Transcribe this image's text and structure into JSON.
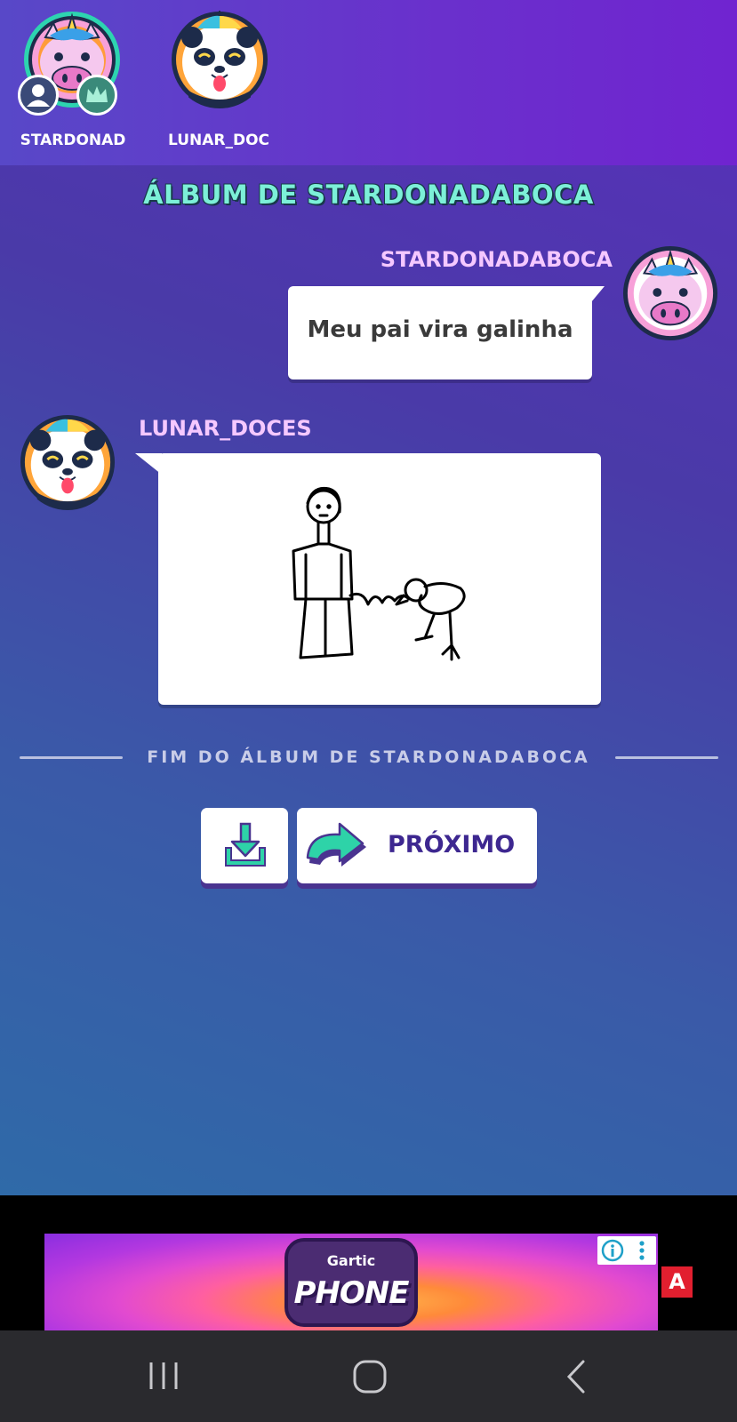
{
  "players": [
    {
      "name": "STARDONAD",
      "avatar": "unicorn-avatar",
      "badges": [
        "user-icon",
        "crown-icon"
      ]
    },
    {
      "name": "LUNAR_DOC",
      "avatar": "panda-avatar"
    }
  ],
  "album_title": "ÁLBUM DE STARDONADABOCA",
  "messages": [
    {
      "author": "STARDONADABOCA",
      "text": "Meu pai vira galinha",
      "avatar": "unicorn-avatar"
    },
    {
      "author": "LUNAR_DOCES",
      "drawing": "stick-figure-man-and-chicken",
      "avatar": "panda-avatar"
    }
  ],
  "end_label": "FIM DO ÁLBUM DE STARDONADABOCA",
  "buttons": {
    "download_icon": "download-icon",
    "next_icon": "curved-arrow-icon",
    "next_label": "PRÓXIMO"
  },
  "ad": {
    "brand_top": "Gartic",
    "brand_main": "PHONE",
    "corner_badge": "A"
  },
  "colors": {
    "title": "#7cf0d8",
    "author": "#f5c8ff",
    "button_text": "#3d2790",
    "ad_badge": "#e21f2f"
  },
  "navbar": [
    "recent-apps-icon",
    "home-icon",
    "back-icon"
  ]
}
